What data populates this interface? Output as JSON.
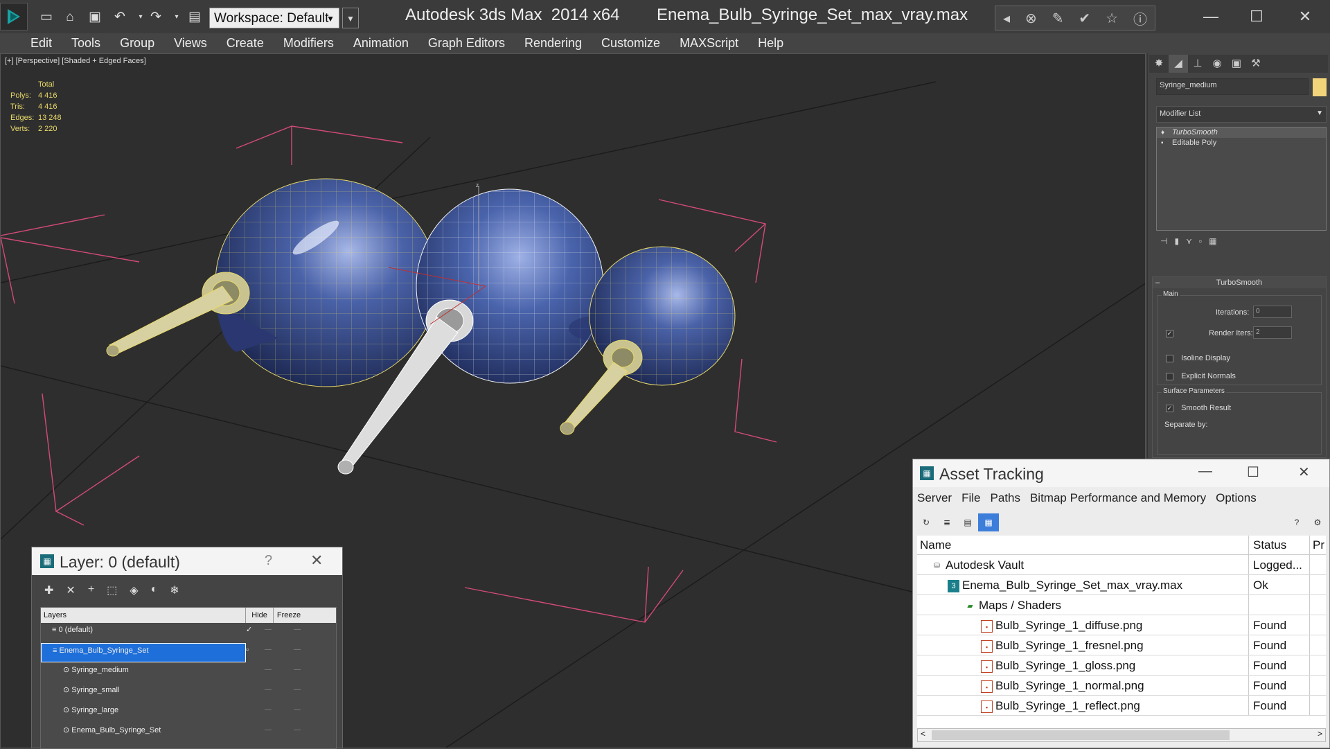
{
  "titlebar": {
    "workspace": "Workspace: Default",
    "app_title": "Autodesk 3ds Max  2014 x64",
    "file_title": "Enema_Bulb_Syringe_Set_max_vray.max"
  },
  "menubar": [
    "Edit",
    "Tools",
    "Group",
    "Views",
    "Create",
    "Modifiers",
    "Animation",
    "Graph Editors",
    "Rendering",
    "Customize",
    "MAXScript",
    "Help"
  ],
  "viewport": {
    "label": "[+] [Perspective] [Shaded + Edged Faces]",
    "stats_header": "Total",
    "stats": [
      {
        "k": "Polys:",
        "v": "4 416"
      },
      {
        "k": "Tris:",
        "v": "4 416"
      },
      {
        "k": "Edges:",
        "v": "13 248"
      },
      {
        "k": "Verts:",
        "v": "2 220"
      }
    ]
  },
  "command_panel": {
    "object_name": "Syringe_medium",
    "object_color": "#f2d47b",
    "modifier_list": "Modifier List",
    "stack": [
      "TurboSmooth",
      "Editable Poly"
    ],
    "rollout_title": "TurboSmooth",
    "group_main": "Main",
    "iterations_label": "Iterations:",
    "iterations_value": "0",
    "render_iters_label": "Render Iters:",
    "render_iters_value": "2",
    "isoline_label": "Isoline Display",
    "explicit_label": "Explicit Normals",
    "group_surface": "Surface Parameters",
    "smooth_result_label": "Smooth Result",
    "separate_label": "Separate by:"
  },
  "asset_tracking": {
    "title": "Asset Tracking",
    "menu": [
      "Server",
      "File",
      "Paths",
      "Bitmap Performance and Memory",
      "Options"
    ],
    "columns": {
      "name": "Name",
      "status": "Status",
      "p": "Pr"
    },
    "rows": [
      {
        "name": "Autodesk Vault",
        "status": "Logged...",
        "indent": 1,
        "icon": "vault-icon"
      },
      {
        "name": "Enema_Bulb_Syringe_Set_max_vray.max",
        "status": "Ok",
        "indent": 2,
        "icon": "max-file-icon"
      },
      {
        "name": "Maps / Shaders",
        "status": "",
        "indent": 3,
        "icon": "folder-icon"
      },
      {
        "name": "Bulb_Syringe_1_diffuse.png",
        "status": "Found",
        "indent": 4,
        "icon": "png-file-icon"
      },
      {
        "name": "Bulb_Syringe_1_fresnel.png",
        "status": "Found",
        "indent": 4,
        "icon": "png-file-icon"
      },
      {
        "name": "Bulb_Syringe_1_gloss.png",
        "status": "Found",
        "indent": 4,
        "icon": "png-file-icon"
      },
      {
        "name": "Bulb_Syringe_1_normal.png",
        "status": "Found",
        "indent": 4,
        "icon": "png-file-icon"
      },
      {
        "name": "Bulb_Syringe_1_reflect.png",
        "status": "Found",
        "indent": 4,
        "icon": "png-file-icon"
      }
    ]
  },
  "layer_dialog": {
    "title": "Layer: 0 (default)",
    "help": "?",
    "columns": {
      "layers": "Layers",
      "hide": "Hide",
      "freeze": "Freeze"
    },
    "rows": [
      {
        "name": "0 (default)",
        "active": true
      },
      {
        "name": "Enema_Bulb_Syringe_Set",
        "selected": true
      },
      {
        "name": "Syringe_medium"
      },
      {
        "name": "Syringe_small"
      },
      {
        "name": "Syringe_large"
      },
      {
        "name": "Enema_Bulb_Syringe_Set"
      }
    ]
  }
}
